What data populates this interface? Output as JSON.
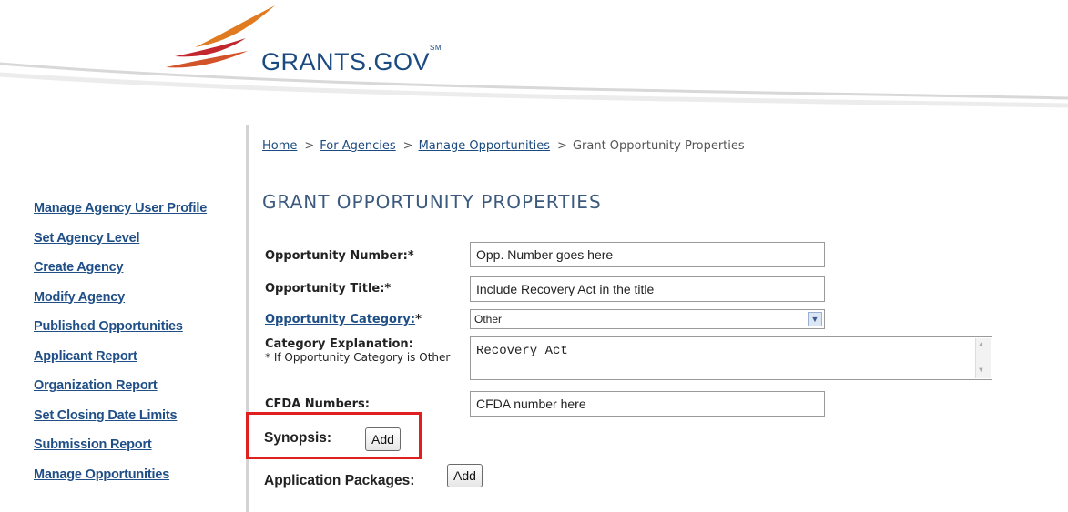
{
  "header": {
    "logo_text": "GRANTS.GOV",
    "logo_mark": "SM",
    "colors": {
      "swoosh_red": "#c1272d",
      "swoosh_orange": "#e07b22",
      "brand_blue": "#1a4a7f"
    }
  },
  "sidebar": {
    "items": [
      {
        "label": "Manage Agency User Profile"
      },
      {
        "label": "Set Agency Level"
      },
      {
        "label": "Create Agency"
      },
      {
        "label": "Modify Agency"
      },
      {
        "label": "Published Opportunities"
      },
      {
        "label": "Applicant Report"
      },
      {
        "label": "Organization Report"
      },
      {
        "label": "Set Closing Date Limits"
      },
      {
        "label": "Submission Report"
      },
      {
        "label": "Manage Opportunities"
      }
    ]
  },
  "breadcrumb": {
    "home": "Home",
    "for_agencies": "For Agencies",
    "manage_opportunities": "Manage Opportunities",
    "current": "Grant Opportunity Properties",
    "separator": ">"
  },
  "page": {
    "title": "GRANT OPPORTUNITY PROPERTIES"
  },
  "form": {
    "opportunity_number": {
      "label": "Opportunity Number:*",
      "value": "Opp. Number goes here"
    },
    "opportunity_title": {
      "label": "Opportunity Title:*",
      "value": "Include Recovery Act in the title"
    },
    "opportunity_category": {
      "label": "Opportunity Category:",
      "required": "*",
      "selected": "Other"
    },
    "category_explanation": {
      "label": "Category Explanation:",
      "note": "* If Opportunity Category is Other",
      "value": "Recovery Act"
    },
    "cfda_numbers": {
      "label": "CFDA Numbers:",
      "value": "CFDA number here"
    },
    "synopsis": {
      "label": "Synopsis:",
      "button": "Add"
    },
    "application_packages": {
      "label": "Application Packages:",
      "button": "Add"
    },
    "highlight_color": "#e0201f"
  }
}
